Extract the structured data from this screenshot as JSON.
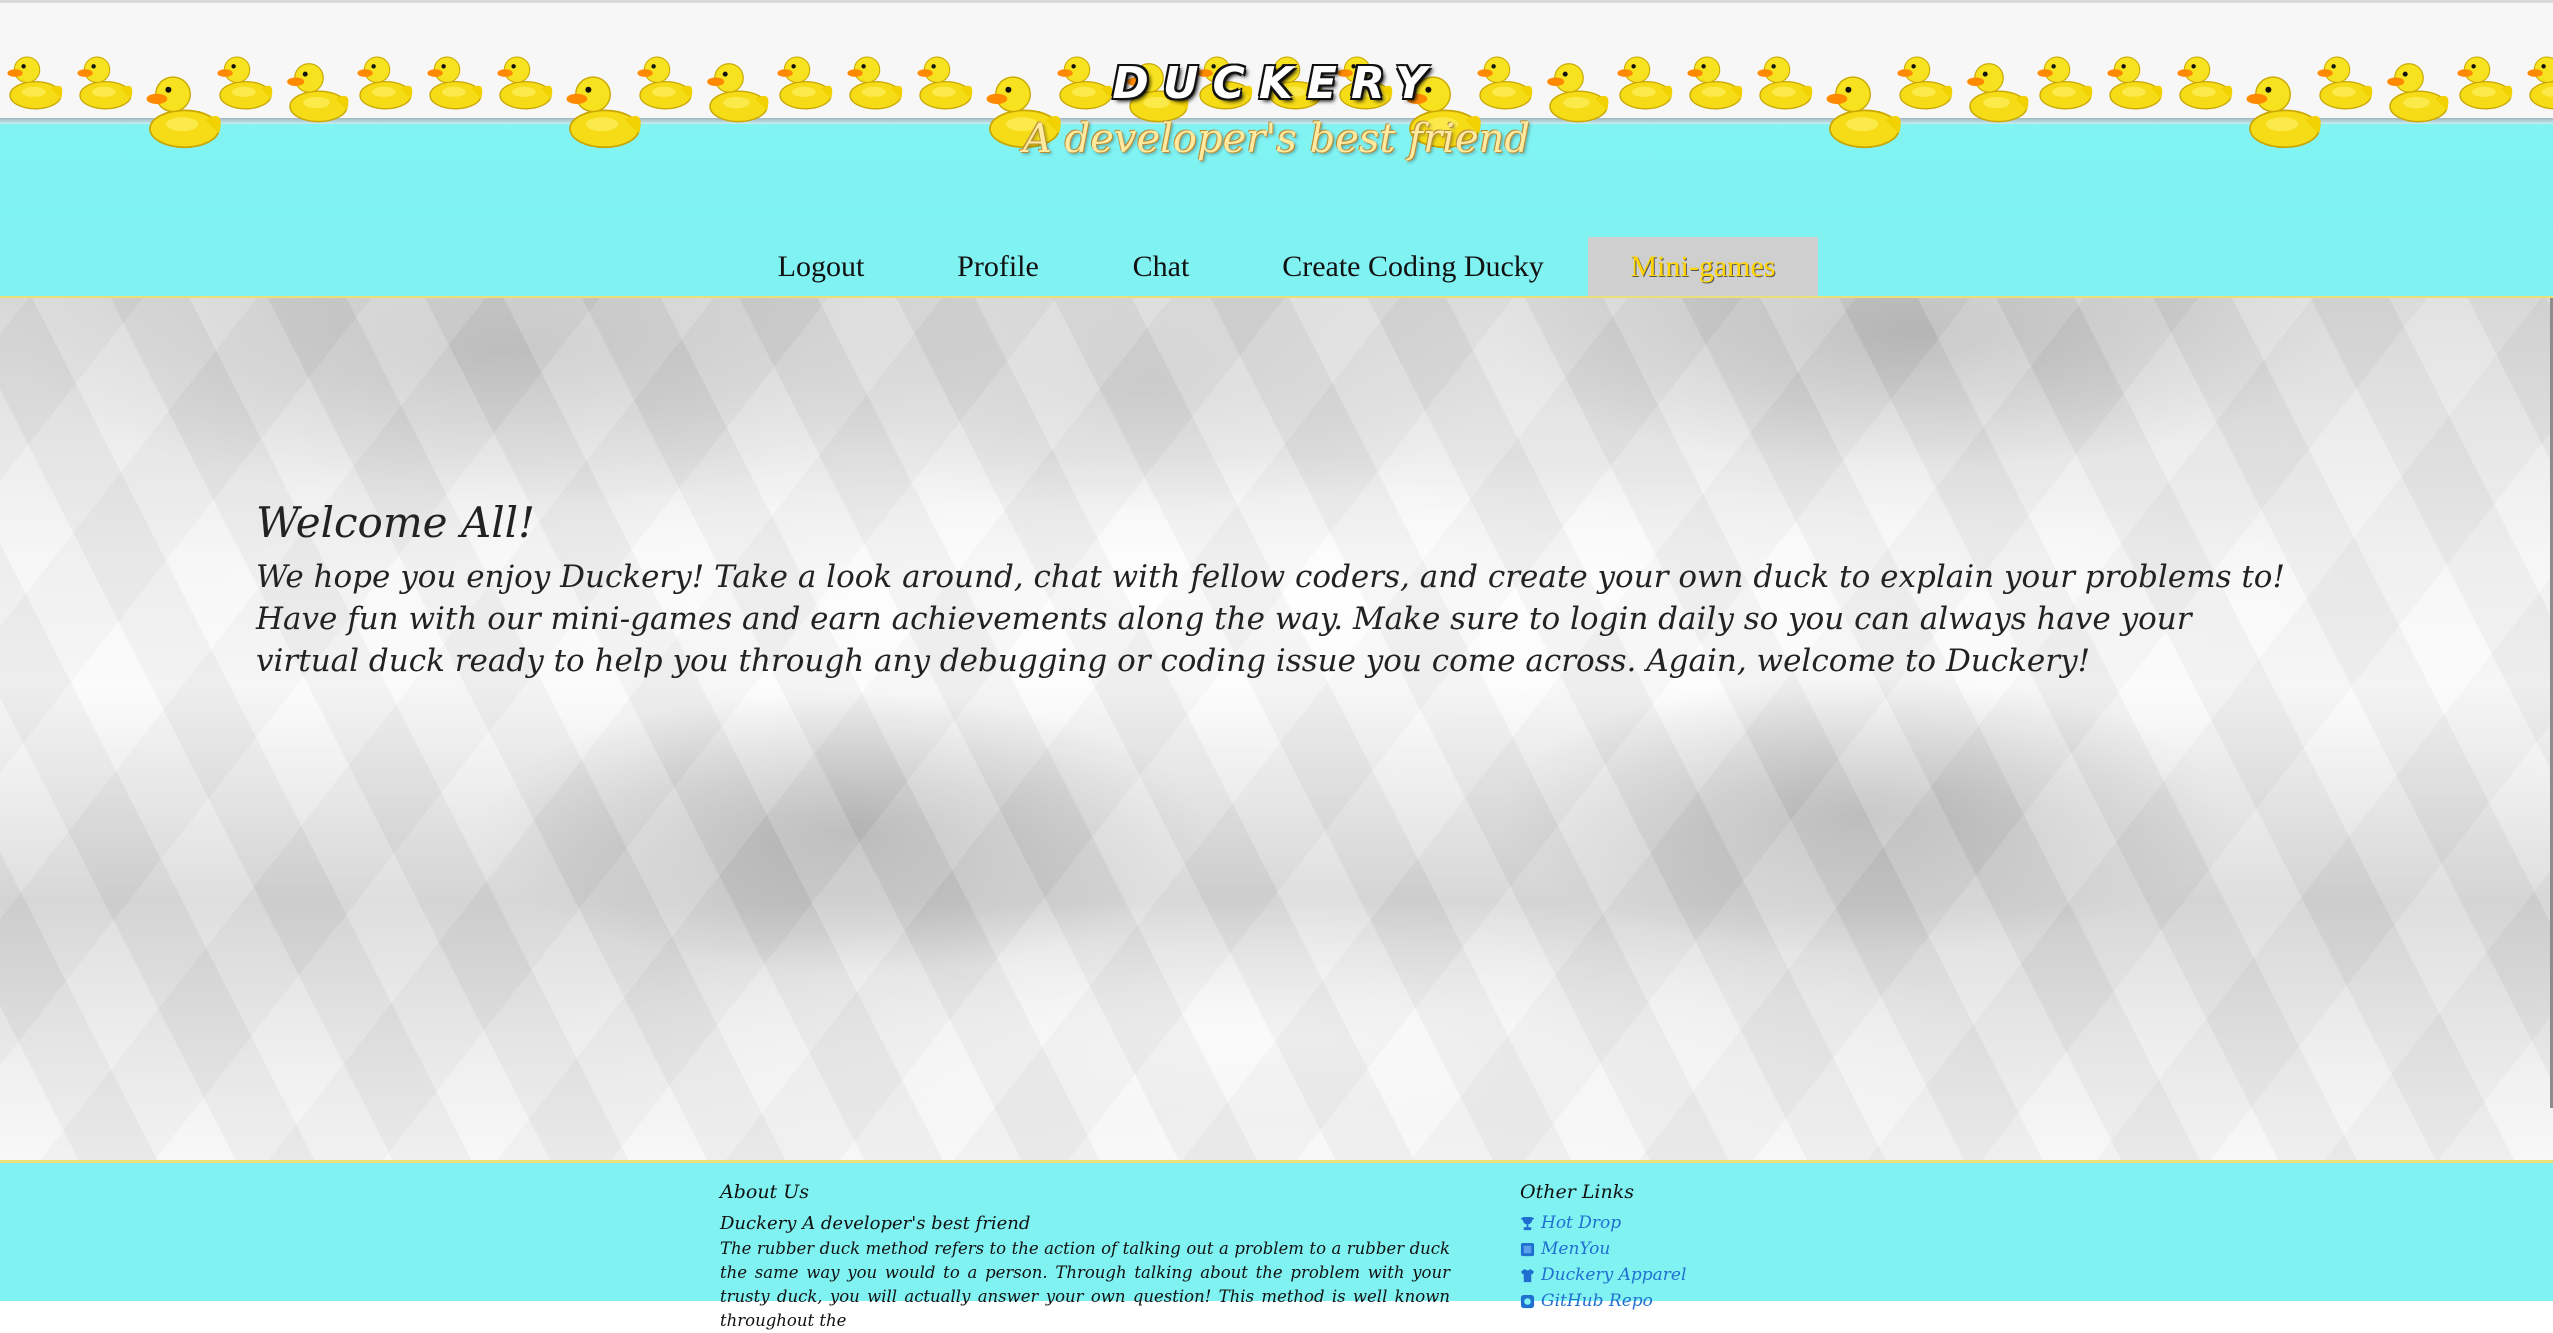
{
  "header": {
    "title": "DUCKERY",
    "subtitle": "A developer's best friend"
  },
  "nav": {
    "items": [
      {
        "label": "Logout"
      },
      {
        "label": "Profile"
      },
      {
        "label": "Chat"
      },
      {
        "label": "Create Coding Ducky"
      },
      {
        "label": "Mini-games",
        "active": true
      }
    ]
  },
  "main": {
    "heading": "Welcome All!",
    "body": "We hope you enjoy Duckery! Take a look around, chat with fellow coders, and create your own duck to explain your problems to! Have fun with our mini-games and earn achievements along the way. Make sure to login daily so you can always have your virtual duck ready to help you through any debugging or coding issue you come across. Again, welcome to Duckery!"
  },
  "footer": {
    "about": {
      "heading": "About Us",
      "brand": "Duckery",
      "tagline": "A developer's best friend",
      "text": "The rubber duck method refers to the action of talking out a problem to a rubber duck the same way you would to a person. Through talking about the problem with your trusty duck, you will actually answer your own question! This method is well known throughout the"
    },
    "links": {
      "heading": "Other Links",
      "items": [
        {
          "label": "Hot Drop",
          "icon": "trophy-icon"
        },
        {
          "label": "MenYou",
          "icon": "square-icon"
        },
        {
          "label": "Duckery Apparel",
          "icon": "shirt-icon"
        },
        {
          "label": "GitHub Repo",
          "icon": "repo-icon"
        }
      ]
    }
  },
  "colors": {
    "cyan": "#81f2f2",
    "accent_yellow": "#ffd400",
    "link_blue": "#1f6fd0"
  }
}
